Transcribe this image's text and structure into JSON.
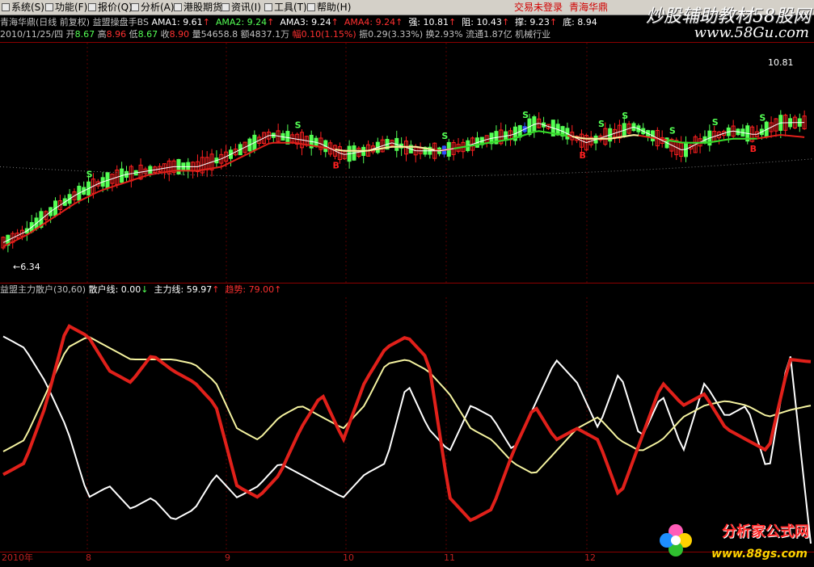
{
  "menubar": {
    "items": [
      {
        "label": "系统(S)",
        "icon": "system-icon"
      },
      {
        "label": "功能(F)",
        "icon": "function-icon"
      },
      {
        "label": "报价(Q)",
        "icon": "quote-icon"
      },
      {
        "label": "分析(A)",
        "icon": "analysis-icon"
      },
      {
        "label": "港股期货",
        "icon": "hk-futures-icon"
      },
      {
        "label": "资讯(I)",
        "icon": "news-icon"
      },
      {
        "label": "工具(T)",
        "icon": "tools-icon"
      },
      {
        "label": "帮助(H)",
        "icon": "help-icon"
      }
    ],
    "status_not_logged": "交易未登录",
    "status_stock": "青海华鼎"
  },
  "watermark": {
    "line1": "炒股辅助教材58股网",
    "line2": "www.58Gu.com"
  },
  "indicator_row": {
    "stock": "青海华鼎",
    "period": "(日线 前复权)",
    "formula": "益盟操盘手BS",
    "ama1_label": "AMA1: ",
    "ama1_value": "9.61",
    "ama2_label": "AMA2: ",
    "ama2_value": "9.24",
    "ama3_label": "AMA3: ",
    "ama3_value": "9.24",
    "ama4_label": "AMA4: ",
    "ama4_value": "9.24",
    "strong_label": "强: ",
    "strong_value": "10.81",
    "resist_label": "阻: ",
    "resist_value": "10.43",
    "support_label": "撑: ",
    "support_value": "9.23",
    "bottom_label": "底: ",
    "bottom_value": "8.94"
  },
  "quote_row": {
    "date": "2010/11/25/四",
    "open_label": "开",
    "open": "8.67",
    "high_label": "高",
    "high": "8.96",
    "low_label": "低",
    "low": "8.67",
    "close_label": "收",
    "close": "8.90",
    "volume_label": "量",
    "volume": "54658.8",
    "amount_label": "额",
    "amount": "4837.1万",
    "change_label": "幅",
    "change": "0.10(1.15%)",
    "amplitude_label": "振",
    "amplitude": "0.29(3.33%)",
    "turnover_label": "换",
    "turnover": "2.93%",
    "float_label": "流通",
    "float_shares": "1.87亿",
    "industry": "机械行业"
  },
  "price_panel": {
    "high_mark": "10.81",
    "low_mark": "6.34",
    "signal_buy": "S",
    "signal_sell": "B"
  },
  "indicator_panel": {
    "name": "益盟主力散户(30,60)",
    "retail_label": "散户线: ",
    "retail_value": "0.00",
    "main_label": "主力线: ",
    "main_value": "59.97",
    "trend_label": "趋势: ",
    "trend_value": "79.00"
  },
  "x_axis": {
    "labels": [
      "2010年",
      "8",
      "9",
      "10",
      "11",
      "12"
    ]
  },
  "logo": {
    "text": "分析家公式网",
    "url": "www.88gs.com"
  },
  "colors": {
    "up": "#ff2020",
    "down": "#54ff54",
    "white_line": "#ffffff",
    "red_line": "#e0201a",
    "yellow_line": "#f5f3a0",
    "green_line": "#2adf2a",
    "accent_cyan": "#00e0e0"
  },
  "chart_data": [
    {
      "type": "line",
      "title": "益盟操盘手BS",
      "series": [
        {
          "name": "AMA1",
          "values": [
            6.6,
            6.9,
            7.4,
            7.8,
            8.1,
            8.3,
            8.4,
            8.5,
            8.5,
            8.7,
            9.0,
            9.3,
            9.2,
            9.1,
            8.8,
            8.9,
            9.1,
            8.9,
            8.9,
            9.0,
            9.2,
            9.3,
            9.6,
            9.4,
            9.1,
            9.3,
            9.5,
            9.2,
            8.9,
            9.2,
            9.4,
            9.3,
            9.6,
            9.61
          ]
        },
        {
          "name": "AMA2",
          "values": [
            6.5,
            6.8,
            7.2,
            7.6,
            7.9,
            8.1,
            8.3,
            8.4,
            8.4,
            8.5,
            8.8,
            9.1,
            9.1,
            9.0,
            8.9,
            8.9,
            9.0,
            9.0,
            8.9,
            9.0,
            9.1,
            9.2,
            9.4,
            9.3,
            9.2,
            9.2,
            9.3,
            9.2,
            9.1,
            9.1,
            9.2,
            9.2,
            9.3,
            9.24
          ]
        }
      ]
    },
    {
      "type": "line",
      "title": "益盟主力散户(30,60)",
      "series": [
        {
          "name": "散户线",
          "values": [
            90,
            85,
            70,
            50,
            20,
            25,
            15,
            20,
            10,
            15,
            30,
            20,
            25,
            35,
            30,
            25,
            20,
            30,
            35,
            70,
            50,
            40,
            60,
            55,
            40,
            60,
            80,
            70,
            50,
            75,
            45,
            65,
            40,
            70,
            55,
            60,
            30,
            85,
            0
          ]
        },
        {
          "name": "主力线",
          "values": [
            40,
            45,
            65,
            85,
            90,
            85,
            80,
            80,
            80,
            78,
            70,
            50,
            45,
            55,
            60,
            55,
            50,
            60,
            78,
            80,
            75,
            65,
            50,
            45,
            35,
            30,
            40,
            50,
            55,
            45,
            40,
            45,
            55,
            60,
            62,
            60,
            55,
            58,
            59.97
          ]
        },
        {
          "name": "趋势",
          "values": [
            30,
            35,
            60,
            95,
            90,
            75,
            70,
            82,
            75,
            70,
            60,
            25,
            20,
            30,
            50,
            65,
            45,
            70,
            85,
            90,
            80,
            20,
            10,
            15,
            40,
            60,
            45,
            50,
            45,
            20,
            45,
            70,
            60,
            65,
            50,
            45,
            40,
            80,
            79
          ]
        }
      ]
    }
  ]
}
